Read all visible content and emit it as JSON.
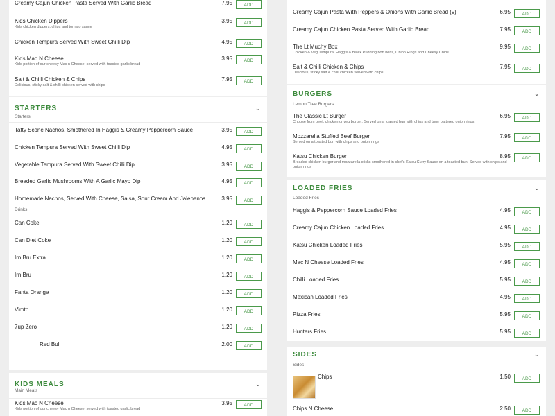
{
  "add_label": "ADD",
  "left": {
    "top_items": [
      {
        "name": "Creamy Cajun Chicken Pasta Served With Garlic Bread",
        "desc": "",
        "price": "7.95"
      },
      {
        "name": "Kids Chicken Dippers",
        "desc": "Kids chicken dippers, chips and tomato sauce",
        "price": "3.95"
      },
      {
        "name": "Chicken Tempura Served With Sweet Chilli Dip",
        "desc": "",
        "price": "4.95"
      },
      {
        "name": "Kids Mac N Cheese",
        "desc": "Kids portion of our cheesy Mac n Cheese, served with toasted garlic bread",
        "price": "3.95"
      },
      {
        "name": "Salt & Chilli Chicken & Chips",
        "desc": "Delicious, sticky salt & chilli chicken served with chips",
        "price": "7.95"
      }
    ],
    "starters": {
      "title": "STARTERS",
      "subtitle": "Starters",
      "items": [
        {
          "name": "Tatty Scone Nachos, Smothered In Haggis & Creamy Peppercorn Sauce",
          "desc": "",
          "price": "3.95"
        },
        {
          "name": "Chicken Tempura Served With Sweet Chilli Dip",
          "desc": "",
          "price": "4.95"
        },
        {
          "name": "Vegetable Tempura Served With Sweet Chilli Dip",
          "desc": "",
          "price": "3.95"
        },
        {
          "name": "Breaded Garlic Mushrooms With A Garlic Mayo Dip",
          "desc": "",
          "price": "4.95"
        },
        {
          "name": "Homemade Nachos, Served With Cheese, Salsa, Sour Cream And Jalepenos",
          "desc": "",
          "price": "3.95"
        }
      ],
      "drinks_subtitle": "Drinks",
      "drinks": [
        {
          "name": "Can Coke",
          "price": "1.20"
        },
        {
          "name": "Can Diet Coke",
          "price": "1.20"
        },
        {
          "name": "Irn Bru Extra",
          "price": "1.20"
        },
        {
          "name": "Irn Bru",
          "price": "1.20"
        },
        {
          "name": "Fanta Orange",
          "price": "1.20"
        },
        {
          "name": "Vimto",
          "price": "1.20"
        },
        {
          "name": "7up Zero",
          "price": "1.20"
        },
        {
          "name": "Red Bull",
          "price": "2.00"
        }
      ]
    },
    "kids": {
      "title": "KIDS MEALS",
      "subtitle": "Main Meals",
      "items": [
        {
          "name": "Kids Mac N Cheese",
          "desc": "Kids portion of our cheesy Mac n Cheese, served with toasted garlic bread",
          "price": "3.95"
        }
      ]
    }
  },
  "right": {
    "top_items": [
      {
        "name": "Creamy Cajun Pasta With Peppers & Onions With Garlic Bread (v)",
        "desc": "",
        "price": "6.95"
      },
      {
        "name": "Creamy Cajun Chicken Pasta Served With Garlic Bread",
        "desc": "",
        "price": "7.95"
      },
      {
        "name": "The Lt Muchy Box",
        "desc": "Chicken & Veg Tempura, Haggis & Black Pudding bon bons, Onion Rings and Cheesy Chips",
        "price": "9.95"
      },
      {
        "name": "Salt & Chilli Chicken & Chips",
        "desc": "Delicious, sticky salt & chilli chicken served with chips",
        "price": "7.95"
      }
    ],
    "burgers": {
      "title": "BURGERS",
      "subtitle": "Lemon Tree Burgers",
      "items": [
        {
          "name": "The Classic Lt Burger",
          "desc": "Choose from beef, chicken or veg burger. Served on a toasted bun with chips and beer battered onion rings",
          "desc2": "",
          "price": "6.95"
        },
        {
          "name": "Mozzarella Stuffed Beef Burger",
          "desc": "Served on a toasted bun with chips and onion rings",
          "desc2": "",
          "price": "7.95"
        },
        {
          "name": "Katsu Chicken Burger",
          "desc": "Breaded chicken burger and mozzarella sticks smothered in chef's Katsu Curry Sauce on a toasted bun. Served with chips and",
          "desc2": "onion rings",
          "price": "8.95"
        }
      ]
    },
    "loaded": {
      "title": "LOADED FRIES",
      "subtitle": "Loaded Fries",
      "items": [
        {
          "name": "Haggis & Peppercorn Sauce Loaded Fries",
          "price": "4.95"
        },
        {
          "name": "Creamy Cajun Chicken Loaded Fries",
          "price": "4.95"
        },
        {
          "name": "Katsu Chicken Loaded Fries",
          "price": "5.95"
        },
        {
          "name": "Mac N Cheese Loaded Fries",
          "price": "4.95"
        },
        {
          "name": "Chilli Loaded Fries",
          "price": "5.95"
        },
        {
          "name": "Mexican Loaded Fries",
          "price": "4.95"
        },
        {
          "name": "Pizza Fries",
          "price": "5.95"
        },
        {
          "name": "Hunters Fries",
          "price": "5.95"
        }
      ]
    },
    "sides": {
      "title": "SIDES",
      "subtitle": "Sides",
      "items": [
        {
          "name": "Chips",
          "price": "1.50"
        },
        {
          "name": "Chips N Cheese",
          "price": "2.50"
        }
      ]
    }
  }
}
